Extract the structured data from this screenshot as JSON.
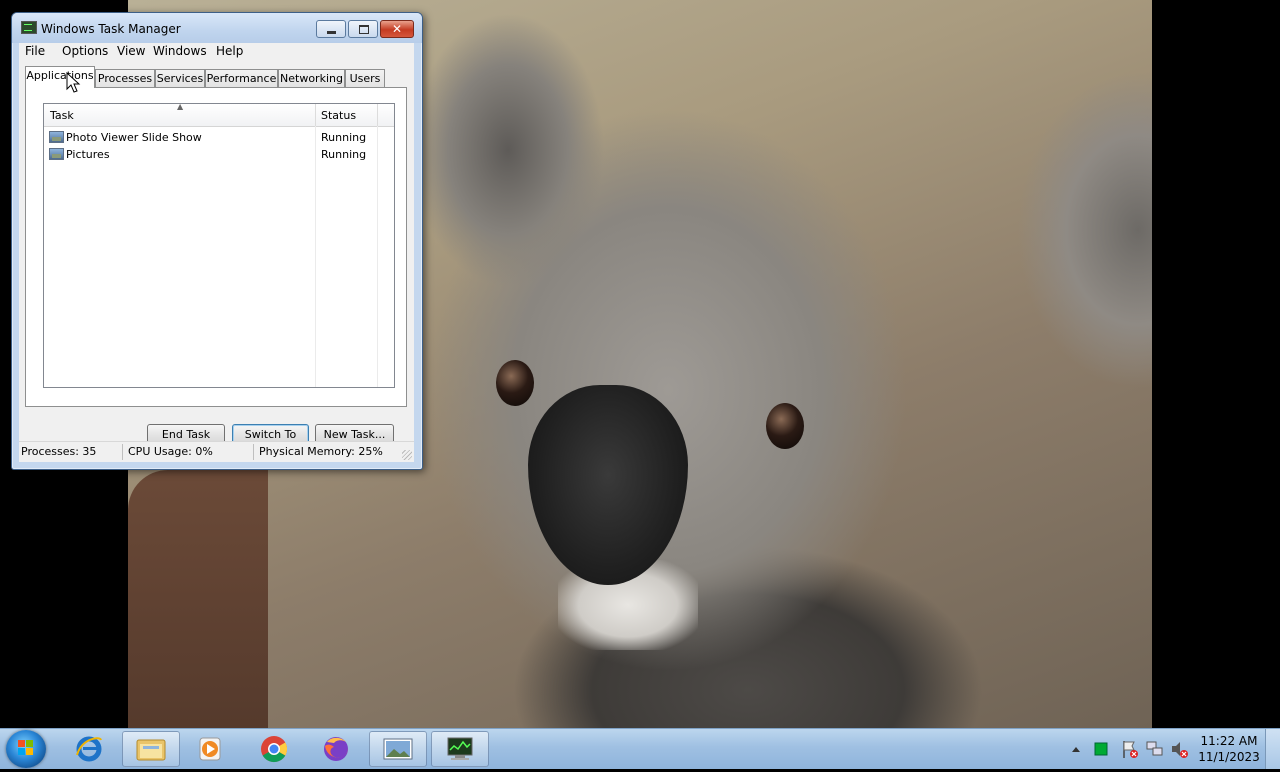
{
  "window": {
    "title": "Windows Task Manager",
    "menu": [
      "File",
      "Options",
      "View",
      "Windows",
      "Help"
    ],
    "tabs": [
      "Applications",
      "Processes",
      "Services",
      "Performance",
      "Networking",
      "Users"
    ],
    "active_tab": "Applications",
    "columns": {
      "task": "Task",
      "status": "Status"
    },
    "rows": [
      {
        "task": "Photo Viewer Slide Show",
        "status": "Running"
      },
      {
        "task": "Pictures",
        "status": "Running"
      }
    ],
    "buttons": {
      "end_task": "End Task",
      "switch_to": "Switch To",
      "new_task": "New Task..."
    },
    "statusbar": {
      "processes": "Processes: 35",
      "cpu": "CPU Usage: 0%",
      "memory": "Physical Memory: 25%"
    },
    "close_glyph": "✕"
  },
  "taskbar": {
    "pinned": [
      "windows-start",
      "internet-explorer",
      "windows-explorer",
      "windows-media-player",
      "google-chrome",
      "firefox",
      "photo-viewer",
      "task-manager"
    ],
    "clock": {
      "time": "11:22 AM",
      "date": "11/1/2023"
    },
    "tray_icons": [
      "show-hidden-icons",
      "task-manager-tray",
      "action-center",
      "network",
      "volume-muted"
    ]
  },
  "colors": {
    "taskbar": "#9fc0e2",
    "title_bar": "#c4d7ee",
    "close_button": "#c53b22"
  }
}
